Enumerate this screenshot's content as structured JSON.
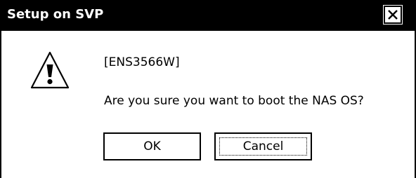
{
  "window": {
    "title": "Setup on SVP",
    "close_icon": "close-icon"
  },
  "message": {
    "icon": "warning-icon",
    "code": "[ENS3566W]",
    "question": "Are you sure you want to boot the NAS OS?"
  },
  "buttons": {
    "ok_label": "OK",
    "cancel_label": "Cancel",
    "default": "Cancel"
  },
  "colors": {
    "titlebar": "#000000",
    "title_text": "#ffffff",
    "background": "#ffffff"
  }
}
